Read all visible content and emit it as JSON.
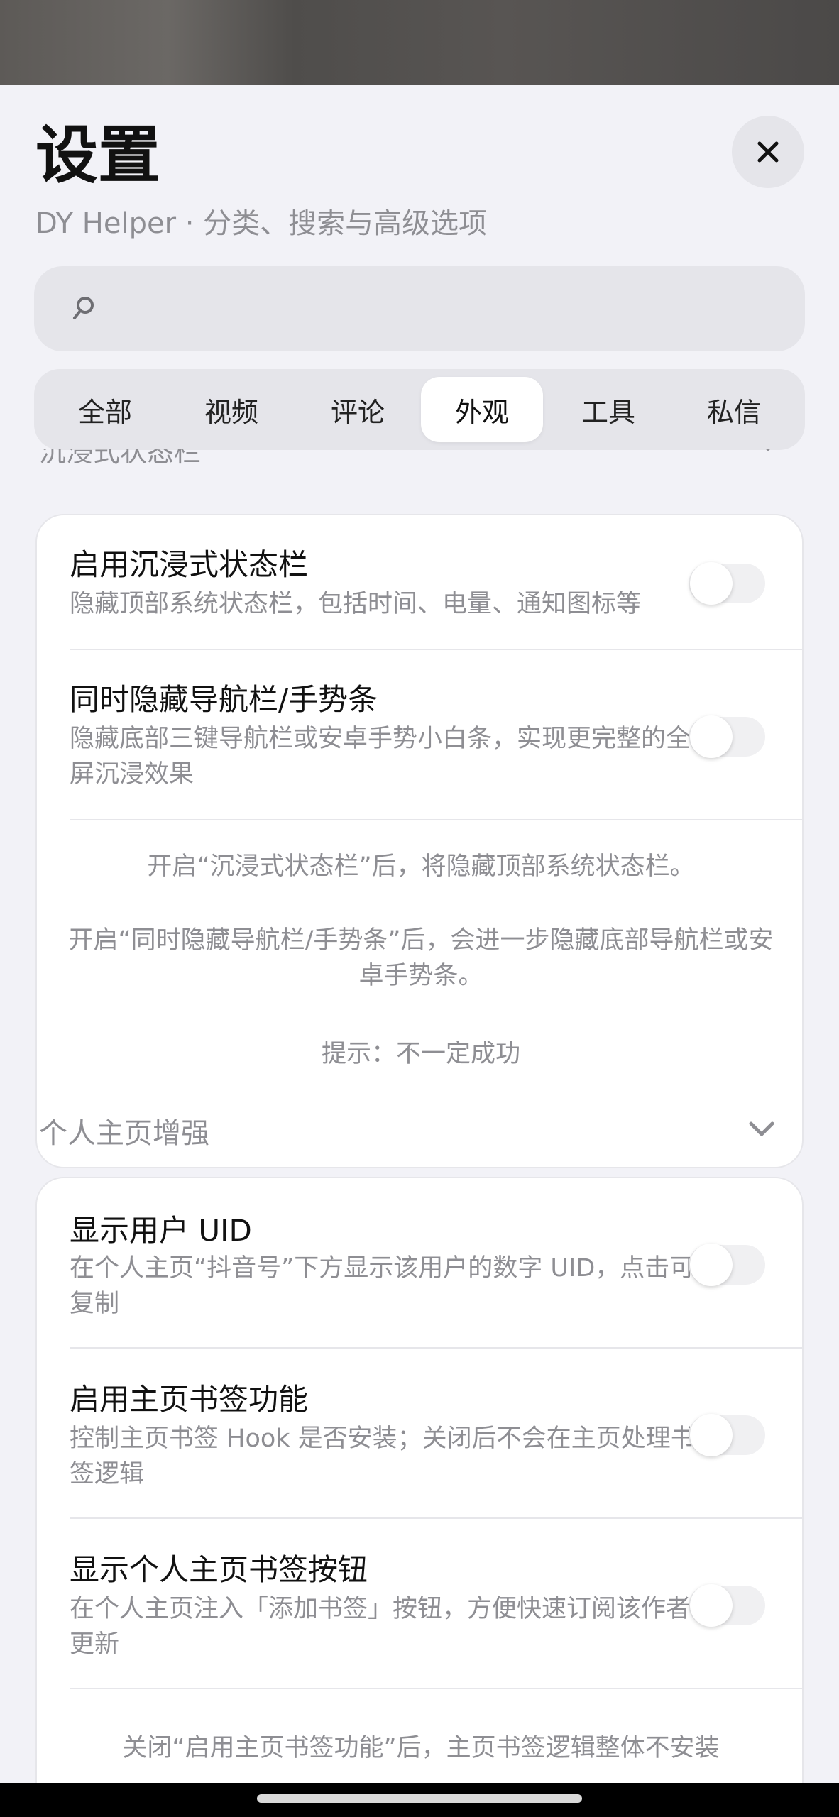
{
  "header": {
    "title": "设置",
    "subtitle": "DY Helper · 分类、搜索与高级选项"
  },
  "search": {
    "placeholder": "",
    "value": ""
  },
  "tabs": [
    {
      "label": "全部",
      "active": false
    },
    {
      "label": "视频",
      "active": false
    },
    {
      "label": "评论",
      "active": false
    },
    {
      "label": "外观",
      "active": true
    },
    {
      "label": "工具",
      "active": false
    },
    {
      "label": "私信",
      "active": false
    }
  ],
  "section_immersive": {
    "header": "沉浸式状态栏",
    "items": [
      {
        "title": "启用沉浸式状态栏",
        "desc": "隐藏顶部系统状态栏，包括时间、电量、通知图标等",
        "on": false
      },
      {
        "title": "同时隐藏导航栏/手势条",
        "desc": "隐藏底部三键导航栏或安卓手势小白条，实现更完整的全屏沉浸效果",
        "on": false
      }
    ],
    "notes": [
      "开启“沉浸式状态栏”后，将隐藏顶部系统状态栏。",
      "开启“同时隐藏导航栏/手势条”后，会进一步隐藏底部导航栏或安卓手势条。",
      "提示：不一定成功"
    ]
  },
  "section_profile": {
    "header": "个人主页增强",
    "items": [
      {
        "title": "显示用户 UID",
        "desc": "在个人主页“抖音号”下方显示该用户的数字 UID，点击可复制",
        "on": false
      },
      {
        "title": "启用主页书签功能",
        "desc": "控制主页书签 Hook 是否安装；关闭后不会在主页处理书签逻辑",
        "on": false
      },
      {
        "title": "显示个人主页书签按钮",
        "desc": "在个人主页注入「添加书签」按钮，方便快速订阅该作者更新",
        "on": false
      }
    ],
    "notes": [
      "关闭“启用主页书签功能”后，主页书签逻辑整体不安装"
    ]
  },
  "colors": {
    "sheet_bg": "#f2f2f7",
    "card_bg": "#ffffff",
    "secondary_text": "#8e8e93",
    "toggle_off": "#f0f0f2"
  },
  "icons": {
    "close": "close-icon",
    "search": "search-icon",
    "chevron": "chevron-down-icon"
  }
}
